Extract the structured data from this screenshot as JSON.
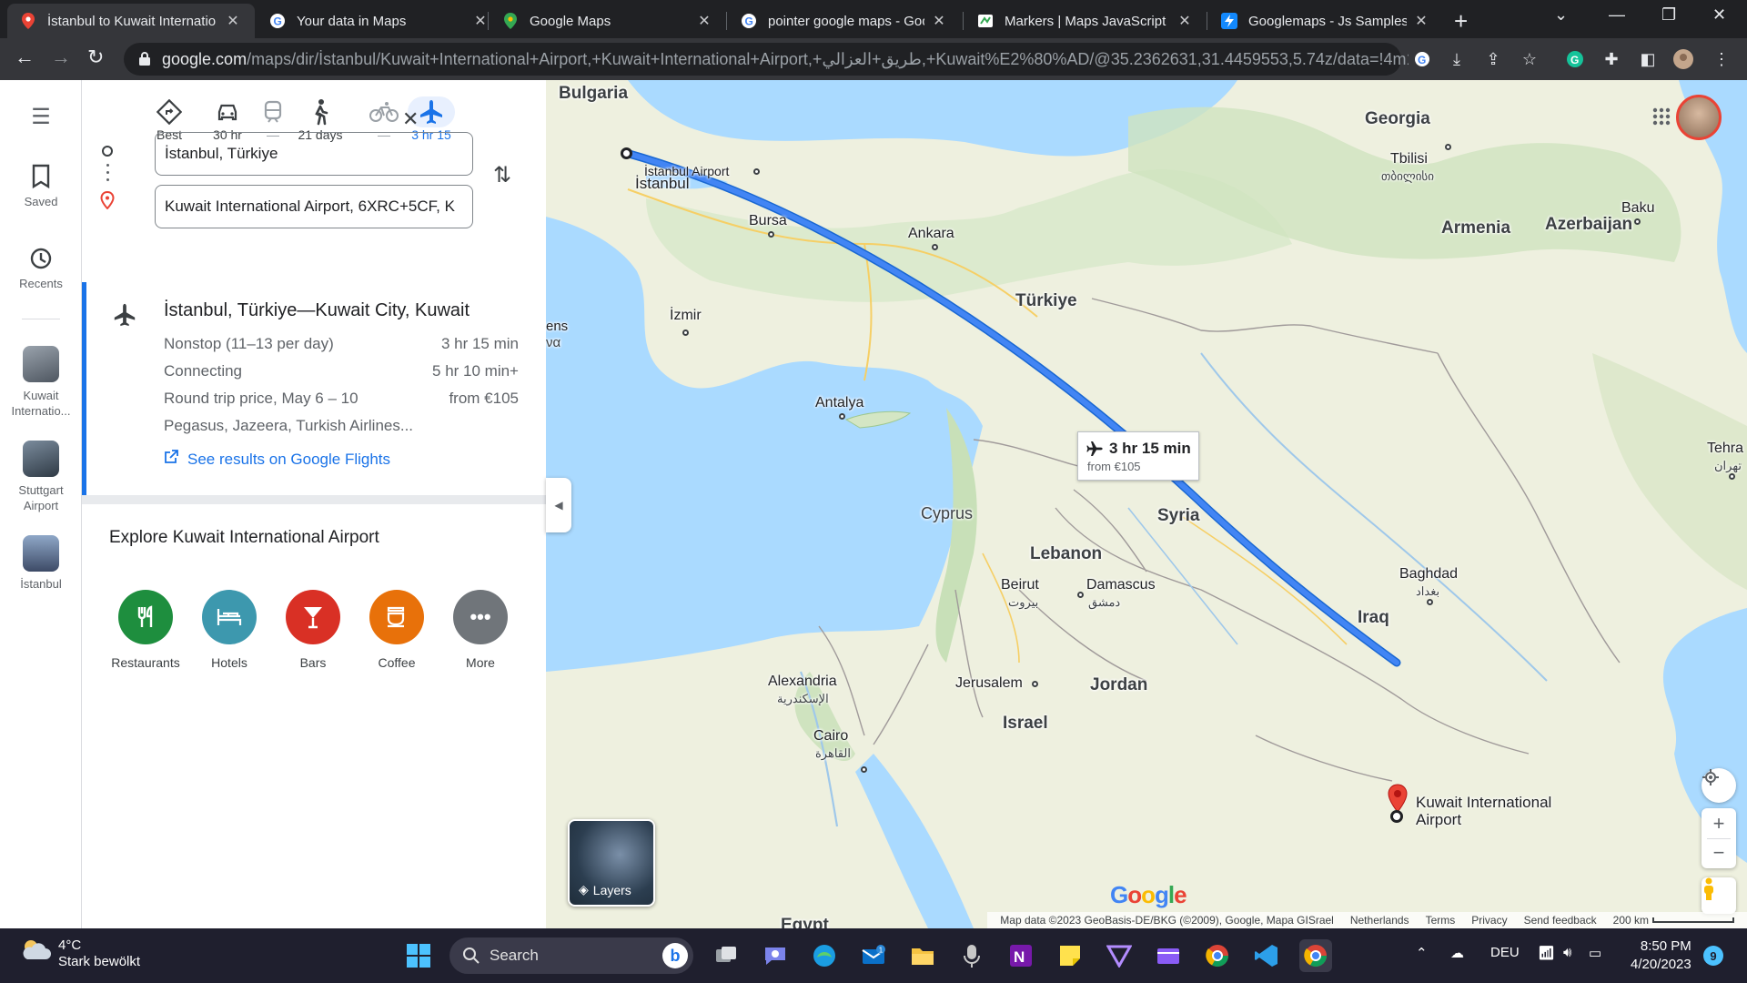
{
  "browser": {
    "tabs": [
      {
        "title": "İstanbul to Kuwait Internatio",
        "icon": "google-maps-icon",
        "active": true
      },
      {
        "title": "Your data in Maps",
        "icon": "google-icon"
      },
      {
        "title": "Google Maps",
        "icon": "google-maps-icon"
      },
      {
        "title": "pointer google maps - Goo",
        "icon": "google-icon"
      },
      {
        "title": "Markers  |  Maps JavaScript",
        "icon": "maps-api-icon"
      },
      {
        "title": "Googlemaps - Js Samples -",
        "icon": "bolt-icon"
      }
    ],
    "url_host": "google.com",
    "url_path": "/maps/dir/İstanbul/Kuwait+International+Airport,+Kuwait+International+Airport,+طريق+العزالي,+Kuwait%E2%80%AD/@35.2362631,31.4459553,5.74z/data=!4m1..."
  },
  "rail": {
    "items": [
      {
        "label": "Saved",
        "icon": "bookmark-icon"
      },
      {
        "label": "Recents",
        "icon": "history-icon"
      },
      {
        "label": "Kuwait Internatio...",
        "thumb": "#6c7480"
      },
      {
        "label": "Stuttgart Airport",
        "thumb": "#4a5a6a"
      },
      {
        "label": "İstanbul",
        "thumb": "#5d6e8a"
      }
    ]
  },
  "directions": {
    "modes": [
      {
        "label": "Best",
        "icon": "diamond-directions-icon"
      },
      {
        "label": "30 hr",
        "icon": "car-icon"
      },
      {
        "label": "—",
        "icon": "train-icon"
      },
      {
        "label": "21 days",
        "icon": "walk-icon"
      },
      {
        "label": "—",
        "icon": "bike-icon"
      },
      {
        "label": "3 hr 15",
        "icon": "plane-icon",
        "selected": true
      }
    ],
    "origin": "İstanbul, Türkiye",
    "destination": "Kuwait International Airport, 6XRC+5CF, K"
  },
  "route": {
    "title": "İstanbul, Türkiye—Kuwait City, Kuwait",
    "rows": [
      {
        "left": "Nonstop (11–13 per day)",
        "right": "3 hr 15 min"
      },
      {
        "left": "Connecting",
        "right": "5 hr 10 min+"
      },
      {
        "left": "Round trip price, May 6 – 10",
        "right": "from €105"
      },
      {
        "left": "Pegasus, Jazeera, Turkish Airlines...",
        "right": ""
      }
    ],
    "link": "See results on Google Flights"
  },
  "explore": {
    "title": "Explore Kuwait International Airport",
    "categories": [
      {
        "label": "Restaurants",
        "color": "#1e8e3e",
        "icon": "fork-knife-icon"
      },
      {
        "label": "Hotels",
        "color": "#3d98ae",
        "icon": "bed-icon"
      },
      {
        "label": "Bars",
        "color": "#d93025",
        "icon": "cocktail-icon"
      },
      {
        "label": "Coffee",
        "color": "#e8710a",
        "icon": "coffee-icon"
      },
      {
        "label": "More",
        "color": "#70757a",
        "icon": "more-icon"
      }
    ]
  },
  "map": {
    "labels": {
      "bulgaria": "Bulgaria",
      "georgia": "Georgia",
      "tbilisi": "Tbilisi",
      "tbilisi_local": "თბილისი",
      "istanbul_airport": "İstanbul Airport",
      "istanbul": "İstanbul",
      "bursa": "Bursa",
      "ankara": "Ankara",
      "armenia": "Armenia",
      "azerbaijan": "Azerbaijan",
      "baku": "Baku",
      "turkiye": "Türkiye",
      "izmir": "İzmir",
      "antalya": "Antalya",
      "cyprus": "Cyprus",
      "syria": "Syria",
      "lebanon": "Lebanon",
      "beirut": "Beirut",
      "beirut_local": "بيروت",
      "damascus": "Damascus",
      "damascus_local": "دمشق",
      "baghdad": "Baghdad",
      "baghdad_local": "بغداد",
      "iraq": "Iraq",
      "alexandria": "Alexandria",
      "alexandria_local": "الإسكندرية",
      "jerusalem": "Jerusalem",
      "jordan": "Jordan",
      "israel": "Israel",
      "cairo": "Cairo",
      "cairo_local": "القاهرة",
      "egypt": "Egypt",
      "tehran": "Tehra",
      "tehran_local": "تهران",
      "athens_partial": "ens",
      "athens_partial2": "να",
      "kuwait_airport": "Kuwait International Airport"
    },
    "flight_box": {
      "duration": "3 hr 15 min",
      "price": "from €105"
    },
    "layers_label": "Layers",
    "logo": "Google",
    "attribution": [
      "Map data ©2023 GeoBasis-DE/BKG (©2009), Google, Mapa GISrael",
      "Netherlands",
      "Terms",
      "Privacy",
      "Send feedback",
      "200 km"
    ],
    "route_color": "#4285f4"
  },
  "taskbar": {
    "weather_temp": "4°C",
    "weather_desc": "Stark bewölkt",
    "search": "Search",
    "lang": "DEU",
    "time": "8:50 PM",
    "date": "4/20/2023",
    "notif": "9"
  }
}
